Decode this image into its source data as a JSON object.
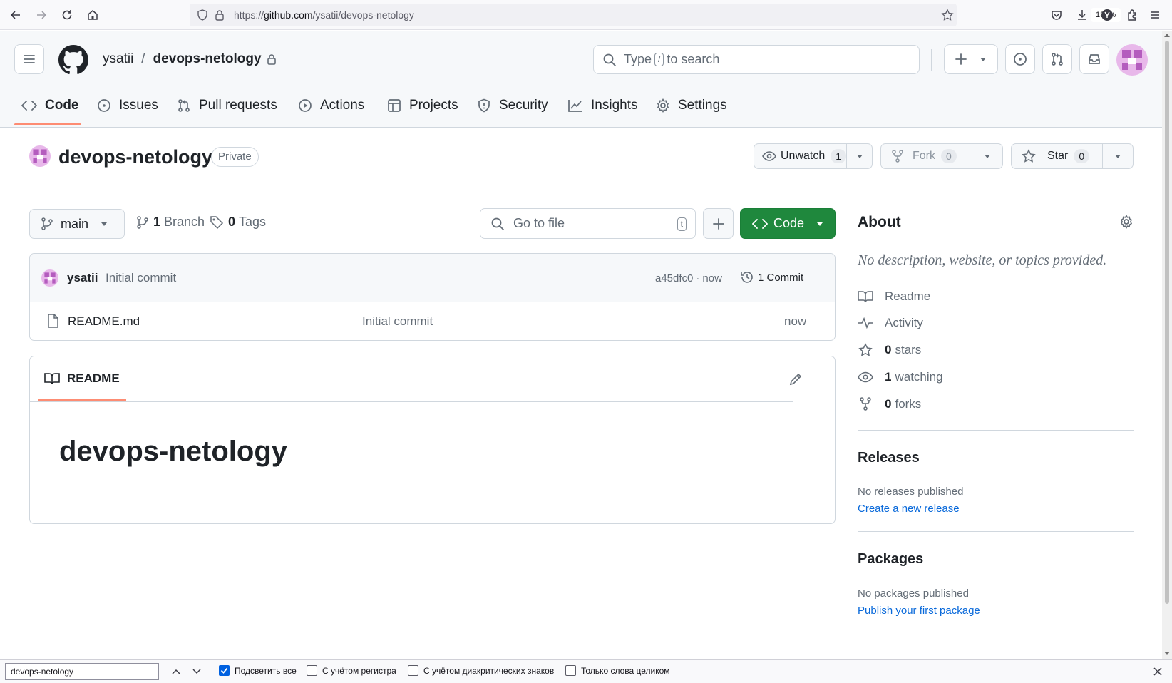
{
  "browser": {
    "url_prefix": "https://",
    "url_host": "github.com",
    "url_path": "/ysatii/devops-netology",
    "zoom": "130%"
  },
  "header": {
    "owner": "ysatii",
    "separator": "/",
    "repo": "devops-netology",
    "search_prefix": "Type",
    "search_key": "/",
    "search_suffix": "to search"
  },
  "tabs": [
    {
      "label": "Code",
      "icon": "code-icon",
      "selected": true
    },
    {
      "label": "Issues",
      "icon": "issue-icon"
    },
    {
      "label": "Pull requests",
      "icon": "pull-request-icon"
    },
    {
      "label": "Actions",
      "icon": "play-icon"
    },
    {
      "label": "Projects",
      "icon": "table-icon"
    },
    {
      "label": "Security",
      "icon": "shield-icon"
    },
    {
      "label": "Insights",
      "icon": "graph-icon"
    },
    {
      "label": "Settings",
      "icon": "gear-icon"
    }
  ],
  "repo": {
    "name": "devops-netology",
    "visibility": "Private",
    "unwatch_label": "Unwatch",
    "watch_count": "1",
    "fork_label": "Fork",
    "fork_count": "0",
    "star_label": "Star",
    "star_count": "0"
  },
  "filenav": {
    "branch": "main",
    "branch_count": "1",
    "branch_label": "Branch",
    "tag_count": "0",
    "tag_label": "Tags",
    "goto_placeholder": "Go to file",
    "goto_key": "t",
    "code_label": "Code"
  },
  "commit": {
    "author": "ysatii",
    "message": "Initial commit",
    "hash": "a45dfc0",
    "dot": "·",
    "time": "now",
    "count_label": "1 Commit"
  },
  "files": [
    {
      "name": "README.md",
      "message": "Initial commit",
      "time": "now"
    }
  ],
  "readme": {
    "tab_label": "README",
    "heading": "devops-netology"
  },
  "about": {
    "title": "About",
    "description": "No description, website, or topics provided.",
    "readme": "Readme",
    "activity": "Activity",
    "stars_count": "0",
    "stars_label": "stars",
    "watching_count": "1",
    "watching_label": "watching",
    "forks_count": "0",
    "forks_label": "forks"
  },
  "releases": {
    "title": "Releases",
    "empty": "No releases published",
    "link": "Create a new release"
  },
  "packages": {
    "title": "Packages",
    "empty": "No packages published",
    "link": "Publish your first package"
  },
  "findbar": {
    "query": "devops-netology",
    "highlight_all": "Подсветить все",
    "match_case": "С учётом регистра",
    "match_diacritics": "С учётом диакритических знаков",
    "whole_words": "Только слова целиком"
  },
  "colors": {
    "accent_underline": "#fd8c73",
    "code_button": "#1f883d",
    "link": "#0969da"
  }
}
